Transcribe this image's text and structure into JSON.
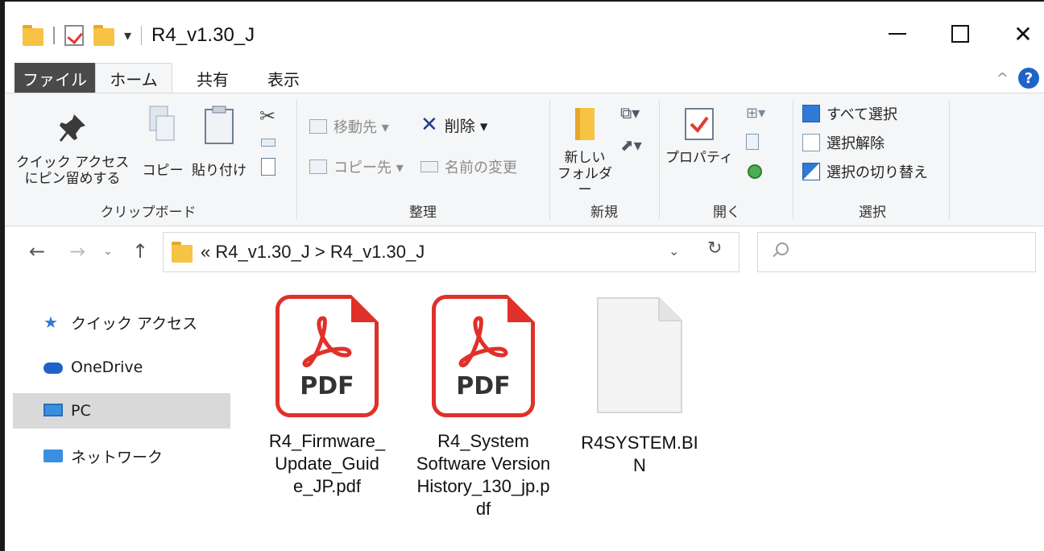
{
  "window": {
    "title": "R4_v1.30_J",
    "minimize_label": "—",
    "close_label": "✕"
  },
  "tabs": {
    "file": "ファイル",
    "home": "ホーム",
    "share": "共有",
    "view": "表示"
  },
  "ribbon": {
    "clipboard": {
      "pin_line1": "クイック アクセス",
      "pin_line2": "にピン留めする",
      "copy": "コピー",
      "paste": "貼り付け",
      "label": "クリップボード"
    },
    "organize": {
      "move_to": "移動先 ▾",
      "copy_to": "コピー先 ▾",
      "delete": "削除 ▾",
      "rename": "名前の変更",
      "label": "整理"
    },
    "new": {
      "new_folder_line1": "新しい",
      "new_folder_line2": "フォルダー",
      "label": "新規"
    },
    "open": {
      "properties": "プロパティ",
      "label": "開く"
    },
    "select": {
      "select_all": "すべて選択",
      "select_none": "選択解除",
      "invert": "選択の切り替え",
      "label": "選択"
    }
  },
  "address": {
    "path": "« R4_v1.30_J > R4_v1.30_J",
    "search_placeholder": ""
  },
  "nav_pane": {
    "items": [
      {
        "label": "クイック アクセス",
        "icon": "star-icon"
      },
      {
        "label": "OneDrive",
        "icon": "cloud-icon"
      },
      {
        "label": "PC",
        "icon": "monitor-icon",
        "selected": true
      },
      {
        "label": "ネットワーク",
        "icon": "network-icon"
      }
    ]
  },
  "files": [
    {
      "name": "R4_Firmware_Update_Guide_JP.pdf",
      "display": "R4_Firmware_\nUpdate_Guid\ne_JP.pdf",
      "type": "pdf",
      "badge": "PDF"
    },
    {
      "name": "R4_System Software Version History_130_jp.pdf",
      "display": "R4_System\nSoftware Version\nHistory_130_jp.p\ndf",
      "type": "pdf",
      "badge": "PDF"
    },
    {
      "name": "R4SYSTEM.BIN",
      "display": "R4SYSTEM.BI\nN",
      "type": "bin"
    }
  ],
  "colors": {
    "pdf_red": "#e0302a",
    "folder_yellow": "#f6c344",
    "accent_blue": "#1f63c9"
  }
}
